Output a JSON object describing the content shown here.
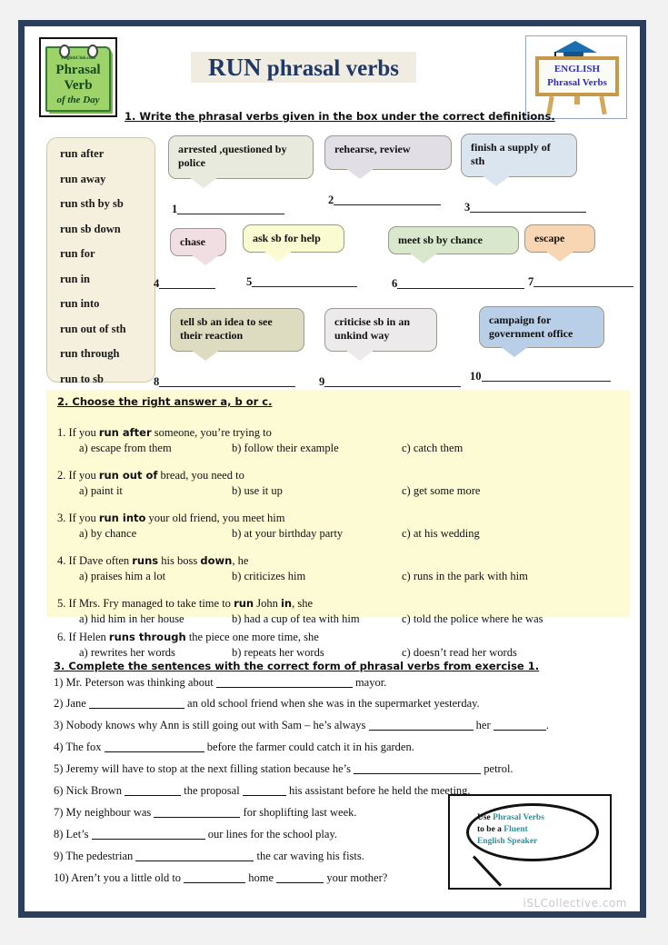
{
  "header": {
    "notepad": {
      "brand": "EnglishClub.com",
      "line1": "Phrasal",
      "line2": "Verb",
      "line3": "of the Day"
    },
    "title_run": "RUN",
    "title_rest": " phrasal verbs",
    "easel": {
      "line1": "ENGLISH",
      "line2": "Phrasal Verbs"
    },
    "instruction1": "1. Write the phrasal verbs given in the box under the correct definitions."
  },
  "verb_box": {
    "items": [
      "run after",
      "run away",
      "run sth by sb",
      "run sb down",
      "run for",
      "run in",
      "run into",
      "run out of sth",
      "run through",
      "run to sb"
    ]
  },
  "definitions": [
    {
      "num": "1",
      "text": "arrested ,questioned by police",
      "color": "#e8eadd"
    },
    {
      "num": "2",
      "text": "rehearse, review",
      "color": "#e2dee6"
    },
    {
      "num": "3",
      "text": "finish a supply of sth",
      "color": "#dbe5ef"
    },
    {
      "num": "4",
      "text": "chase",
      "color": "#f0dee2"
    },
    {
      "num": "5",
      "text": "ask sb for help",
      "color": "#fbfbd2"
    },
    {
      "num": "6",
      "text": "meet sb by chance",
      "color": "#d9e7cc"
    },
    {
      "num": "7",
      "text": "escape",
      "color": "#f8d6b3"
    },
    {
      "num": "8",
      "text": "tell sb an idea to see their reaction",
      "color": "#dedcc0"
    },
    {
      "num": "9",
      "text": "criticise sb in an unkind way",
      "color": "#eceaea"
    },
    {
      "num": "10",
      "text": "campaign for government office",
      "color": "#b9cfe8"
    }
  ],
  "exercise2": {
    "heading": "2. Choose the right answer a, b or c.",
    "questions": [
      {
        "num": "1.",
        "pre": "If you ",
        "bold": "run after",
        "post": " someone, you’re trying to",
        "a": "a) escape from them",
        "b": "b) follow their example",
        "c": "c) catch them"
      },
      {
        "num": "2.",
        "pre": "If you ",
        "bold": "run out of",
        "post": " bread, you need to",
        "a": "a) paint it",
        "b": "b) use it up",
        "c": "c) get some more"
      },
      {
        "num": "3.",
        "pre": "If you ",
        "bold": "run into",
        "post": " your old friend, you meet him",
        "a": "a) by chance",
        "b": "b) at your birthday party",
        "c": "c) at his wedding"
      },
      {
        "num": "4.",
        "pre": "If Dave often ",
        "bold": "runs",
        "post": " his boss ",
        "bold2": "down",
        "post2": ", he",
        "a": "a) praises him a lot",
        "b": "b) criticizes him",
        "c": "c) runs in the park with him"
      },
      {
        "num": "5.",
        "pre": "If Mrs. Fry managed to take time to ",
        "bold": "run",
        "post": " John ",
        "bold2": "in",
        "post2": ", she",
        "a": "a) hid him in her house",
        "b": "b) had a cup of tea with him",
        "c": "c) told the police where he was"
      },
      {
        "num": "6.",
        "pre": "If Helen ",
        "bold": "runs through",
        "post": " the piece one more time, she",
        "a": "a) rewrites her words",
        "b": "b) repeats her words",
        "c": "c) doesn’t read her words"
      }
    ]
  },
  "exercise3": {
    "heading": "3. Complete the sentences with the correct form of phrasal verbs from exercise 1.",
    "sentences": [
      {
        "num": "1)",
        "p1": "Mr. Peterson was thinking about ",
        "b1": 150,
        "p2": " mayor."
      },
      {
        "num": "2)",
        "p1": "Jane ",
        "b1": 105,
        "p2": " an old school friend when she was in the supermarket yesterday."
      },
      {
        "num": "3)",
        "p1": "Nobody knows why Ann is still going out with Sam – he’s always ",
        "b1": 115,
        "p2": " her ",
        "b2": 58,
        "p3": "."
      },
      {
        "num": "4)",
        "p1": "The fox ",
        "b1": 110,
        "p2": " before the farmer could catch it in his garden."
      },
      {
        "num": "5)",
        "p1": "Jeremy will have to stop at the next filling station because he’s ",
        "b1": 140,
        "p2": " petrol."
      },
      {
        "num": "6)",
        "p1": "Nick Brown ",
        "b1": 62,
        "p2": " the proposal ",
        "b2": 48,
        "p3": " his assistant before he held the meeting."
      },
      {
        "num": "7)",
        "p1": "My neighbour was ",
        "b1": 95,
        "p2": " for shoplifting last week."
      },
      {
        "num": "8)",
        "p1": "Let’s ",
        "b1": 125,
        "p2": " our lines for the school play."
      },
      {
        "num": "9)",
        "p1": "The pedestrian ",
        "b1": 130,
        "p2": " the car waving his fists."
      },
      {
        "num": "10)",
        "p1": "Aren’t you a little old to ",
        "b1": 68,
        "p2": " home ",
        "b2": 52,
        "p3": " your mother?"
      }
    ]
  },
  "balloon": {
    "w1": "Use ",
    "w2": "Phrasal Verbs",
    "w3": "to be a ",
    "w4": "Fluent",
    "w5": "English Speaker"
  },
  "watermark": "iSLCollective.com"
}
